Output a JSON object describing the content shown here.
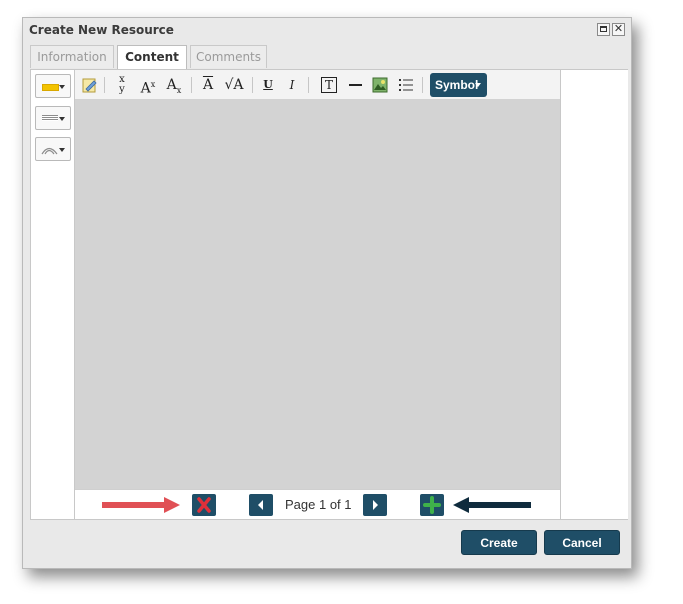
{
  "dialog": {
    "title": "Create New Resource"
  },
  "tabs": [
    {
      "label": "Information",
      "active": false
    },
    {
      "label": "Content",
      "active": true
    },
    {
      "label": "Comments",
      "active": false
    }
  ],
  "side_toolbar": {
    "items": [
      {
        "icon": "highlight-color-icon",
        "color": "#f3c300"
      },
      {
        "icon": "line-style-icon"
      },
      {
        "icon": "curve-style-icon"
      }
    ]
  },
  "toolbar": {
    "symbol_label": "Symbol",
    "icons": [
      "edit-note-icon",
      "fraction-icon",
      "superscript-icon",
      "subscript-icon",
      "overline-icon",
      "root-icon",
      "underline-icon",
      "italic-icon",
      "text-box-icon",
      "horizontal-line-icon",
      "insert-image-icon",
      "list-icon"
    ]
  },
  "pager": {
    "page_label": "Page 1 of 1"
  },
  "footer": {
    "create_label": "Create",
    "cancel_label": "Cancel"
  },
  "colors": {
    "accent": "#1f4e67",
    "delete_red": "#e0303a",
    "add_green": "#3fb24a",
    "arrow_left": "#e05055",
    "arrow_right": "#0f2b3d",
    "canvas": "#d3d3d3"
  }
}
